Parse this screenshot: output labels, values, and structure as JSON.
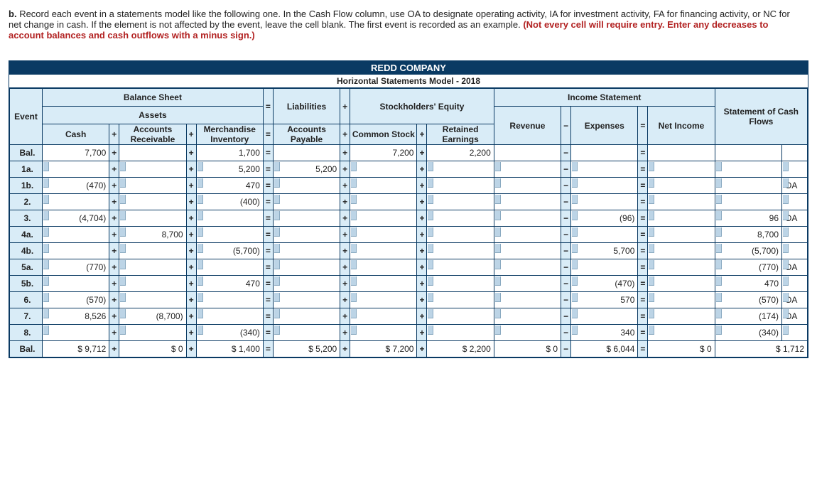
{
  "instructions": {
    "label": "b.",
    "text_part1": "Record each event in a statements model like the following one. In the Cash Flow column, use OA to designate operating activity, IA for investment activity, FA for financing activity, or NC for net change in cash. If the element is not affected by the event, leave the cell blank. The first event is recorded as an example. ",
    "red_text": "(Not every cell will require entry. Enter any decreases to account balances and cash outflows with a minus sign.)"
  },
  "title": "REDD COMPANY",
  "subtitle": "Horizontal Statements Model - 2018",
  "headers": {
    "balance_sheet": "Balance Sheet",
    "income_statement": "Income Statement",
    "event": "Event",
    "assets": "Assets",
    "liabilities": "Liabilities",
    "stockholders_equity": "Stockholders' Equity",
    "stmt_cash_flows": "Statement of Cash Flows",
    "cash": "Cash",
    "accounts_receivable": "Accounts Receivable",
    "merch_inventory": "Merchandise Inventory",
    "accounts_payable": "Accounts Payable",
    "common_stock": "Common Stock",
    "retained_earnings": "Retained Earnings",
    "revenue": "Revenue",
    "expenses": "Expenses",
    "net_income": "Net Income",
    "eq": "=",
    "plus": "+",
    "minus": "−"
  },
  "rows": [
    {
      "label": "Bal.",
      "cash": "7,700",
      "ar": "",
      "inv": "1,700",
      "ap": "",
      "cs": "7,200",
      "re": "2,200",
      "rev": "",
      "exp": "",
      "ni": "",
      "scf": "",
      "flow": "",
      "editable": false
    },
    {
      "label": "1a.",
      "cash": "",
      "ar": "",
      "inv": "5,200",
      "ap": "5,200",
      "cs": "",
      "re": "",
      "rev": "",
      "exp": "",
      "ni": "",
      "scf": "",
      "flow": "",
      "editable": true
    },
    {
      "label": "1b.",
      "cash": "(470)",
      "ar": "",
      "inv": "470",
      "ap": "",
      "cs": "",
      "re": "",
      "rev": "",
      "exp": "",
      "ni": "",
      "scf": "",
      "flow": "OA",
      "editable": true
    },
    {
      "label": "2.",
      "cash": "",
      "ar": "",
      "inv": "(400)",
      "ap": "",
      "cs": "",
      "re": "",
      "rev": "",
      "exp": "",
      "ni": "",
      "scf": "",
      "flow": "",
      "editable": true
    },
    {
      "label": "3.",
      "cash": "(4,704)",
      "ar": "",
      "inv": "",
      "ap": "",
      "cs": "",
      "re": "",
      "rev": "",
      "exp": "(96)",
      "ni": "",
      "scf": "96",
      "flow": "OA",
      "editable": true
    },
    {
      "label": "4a.",
      "cash": "",
      "ar": "8,700",
      "inv": "",
      "ap": "",
      "cs": "",
      "re": "",
      "rev": "",
      "exp": "",
      "ni": "",
      "scf": "8,700",
      "flow": "",
      "editable": true
    },
    {
      "label": "4b.",
      "cash": "",
      "ar": "",
      "inv": "(5,700)",
      "ap": "",
      "cs": "",
      "re": "",
      "rev": "",
      "exp": "5,700",
      "ni": "",
      "scf": "(5,700)",
      "flow": "",
      "editable": true
    },
    {
      "label": "5a.",
      "cash": "(770)",
      "ar": "",
      "inv": "",
      "ap": "",
      "cs": "",
      "re": "",
      "rev": "",
      "exp": "",
      "ni": "",
      "scf": "(770)",
      "flow": "OA",
      "editable": true
    },
    {
      "label": "5b.",
      "cash": "",
      "ar": "",
      "inv": "470",
      "ap": "",
      "cs": "",
      "re": "",
      "rev": "",
      "exp": "(470)",
      "ni": "",
      "scf": "470",
      "flow": "",
      "editable": true
    },
    {
      "label": "6.",
      "cash": "(570)",
      "ar": "",
      "inv": "",
      "ap": "",
      "cs": "",
      "re": "",
      "rev": "",
      "exp": "570",
      "ni": "",
      "scf": "(570)",
      "flow": "OA",
      "editable": true
    },
    {
      "label": "7.",
      "cash": "8,526",
      "ar": "(8,700)",
      "inv": "",
      "ap": "",
      "cs": "",
      "re": "",
      "rev": "",
      "exp": "",
      "ni": "",
      "scf": "(174)",
      "flow": "OA",
      "editable": true
    },
    {
      "label": "8.",
      "cash": "",
      "ar": "",
      "inv": "(340)",
      "ap": "",
      "cs": "",
      "re": "",
      "rev": "",
      "exp": "340",
      "ni": "",
      "scf": "(340)",
      "flow": "",
      "editable": true
    }
  ],
  "footer": {
    "label": "Bal.",
    "cash": "$  9,712",
    "ar": "$          0",
    "inv": "$      1,400",
    "ap": "$  5,200",
    "cs": "$  7,200",
    "re": "$  2,200",
    "rev": "$          0",
    "exp": "$  6,044",
    "ni": "$          0",
    "scf": "$  1,712"
  }
}
